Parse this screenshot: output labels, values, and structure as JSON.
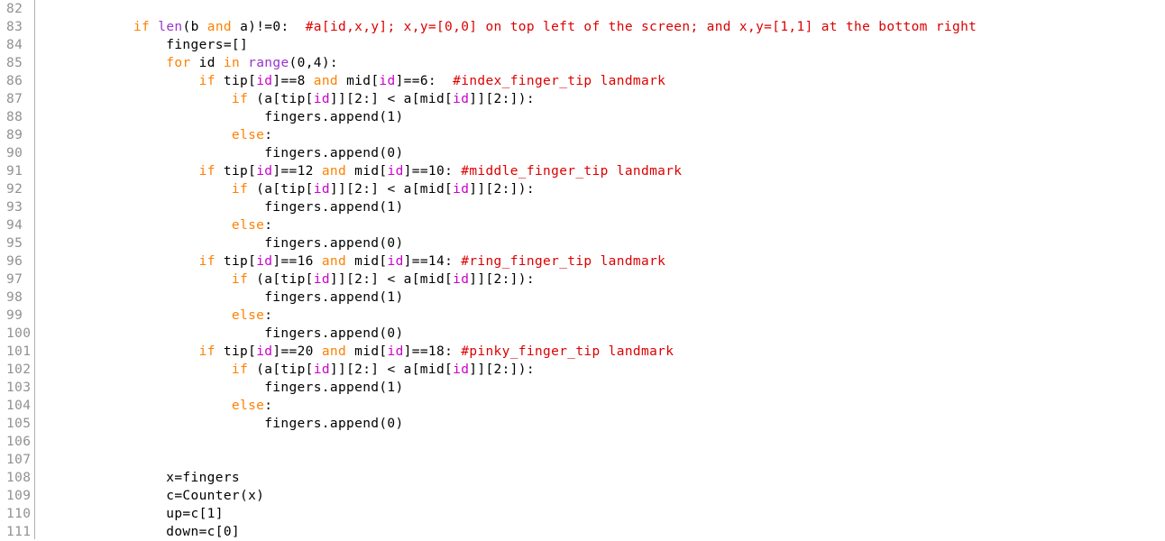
{
  "editor": {
    "language": "python",
    "background": "#ffffff",
    "gutter_text_color": "#8f9193",
    "gutter_border_color": "#b0b0b0",
    "colors": {
      "keyword": "#ff8000",
      "builtin": "#9933cc",
      "variable": "#cc00cc",
      "comment": "#dd0000",
      "default": "#000000"
    },
    "first_line_number": 82,
    "last_line_number": 111,
    "line_numbers": [
      82,
      83,
      84,
      85,
      86,
      87,
      88,
      89,
      90,
      91,
      92,
      93,
      94,
      95,
      96,
      97,
      98,
      99,
      100,
      101,
      102,
      103,
      104,
      105,
      106,
      107,
      108,
      109,
      110,
      111
    ],
    "lines": [
      {
        "number": 82,
        "text": "",
        "tokens": []
      },
      {
        "number": 83,
        "text": "            if len(b and a)!=0:  #a[id,x,y]; x,y=[0,0] on top left of the screen; and x,y=[1,1] at the bottom right",
        "tokens": [
          {
            "t": "            ",
            "c": "txt"
          },
          {
            "t": "if",
            "c": "kw"
          },
          {
            "t": " ",
            "c": "txt"
          },
          {
            "t": "len",
            "c": "bi"
          },
          {
            "t": "(b ",
            "c": "txt"
          },
          {
            "t": "and",
            "c": "kw"
          },
          {
            "t": " a)!=0:  ",
            "c": "txt"
          },
          {
            "t": "#a[id,x,y]; x,y=[0,0] on top left of the screen; and x,y=[1,1] at the bottom right",
            "c": "com"
          }
        ]
      },
      {
        "number": 84,
        "text": "                fingers=[]",
        "tokens": [
          {
            "t": "                fingers=[]",
            "c": "txt"
          }
        ]
      },
      {
        "number": 85,
        "text": "                for id in range(0,4):",
        "tokens": [
          {
            "t": "                ",
            "c": "txt"
          },
          {
            "t": "for",
            "c": "kw"
          },
          {
            "t": " id ",
            "c": "txt"
          },
          {
            "t": "in",
            "c": "kw"
          },
          {
            "t": " ",
            "c": "txt"
          },
          {
            "t": "range",
            "c": "bi"
          },
          {
            "t": "(0,4):",
            "c": "txt"
          }
        ]
      },
      {
        "number": 86,
        "text": "                    if tip[id]==8 and mid[id]==6:  #index_finger_tip landmark",
        "tokens": [
          {
            "t": "                    ",
            "c": "txt"
          },
          {
            "t": "if",
            "c": "kw"
          },
          {
            "t": " tip[",
            "c": "txt"
          },
          {
            "t": "id",
            "c": "var"
          },
          {
            "t": "]==8 ",
            "c": "txt"
          },
          {
            "t": "and",
            "c": "kw"
          },
          {
            "t": " mid[",
            "c": "txt"
          },
          {
            "t": "id",
            "c": "var"
          },
          {
            "t": "]==6:  ",
            "c": "txt"
          },
          {
            "t": "#index_finger_tip landmark",
            "c": "com"
          }
        ]
      },
      {
        "number": 87,
        "text": "                        if (a[tip[id]][2:] < a[mid[id]][2:]):",
        "tokens": [
          {
            "t": "                        ",
            "c": "txt"
          },
          {
            "t": "if",
            "c": "kw"
          },
          {
            "t": " (a[tip[",
            "c": "txt"
          },
          {
            "t": "id",
            "c": "var"
          },
          {
            "t": "]][2:] < a[mid[",
            "c": "txt"
          },
          {
            "t": "id",
            "c": "var"
          },
          {
            "t": "]][2:]):",
            "c": "txt"
          }
        ]
      },
      {
        "number": 88,
        "text": "                            fingers.append(1)",
        "tokens": [
          {
            "t": "                            fingers.append(1)",
            "c": "txt"
          }
        ]
      },
      {
        "number": 89,
        "text": "                        else:",
        "tokens": [
          {
            "t": "                        ",
            "c": "txt"
          },
          {
            "t": "else",
            "c": "kw"
          },
          {
            "t": ":",
            "c": "txt"
          }
        ]
      },
      {
        "number": 90,
        "text": "                            fingers.append(0)",
        "tokens": [
          {
            "t": "                            fingers.append(0)",
            "c": "txt"
          }
        ]
      },
      {
        "number": 91,
        "text": "                    if tip[id]==12 and mid[id]==10: #middle_finger_tip landmark",
        "tokens": [
          {
            "t": "                    ",
            "c": "txt"
          },
          {
            "t": "if",
            "c": "kw"
          },
          {
            "t": " tip[",
            "c": "txt"
          },
          {
            "t": "id",
            "c": "var"
          },
          {
            "t": "]==12 ",
            "c": "txt"
          },
          {
            "t": "and",
            "c": "kw"
          },
          {
            "t": " mid[",
            "c": "txt"
          },
          {
            "t": "id",
            "c": "var"
          },
          {
            "t": "]==10: ",
            "c": "txt"
          },
          {
            "t": "#middle_finger_tip landmark",
            "c": "com"
          }
        ]
      },
      {
        "number": 92,
        "text": "                        if (a[tip[id]][2:] < a[mid[id]][2:]):",
        "tokens": [
          {
            "t": "                        ",
            "c": "txt"
          },
          {
            "t": "if",
            "c": "kw"
          },
          {
            "t": " (a[tip[",
            "c": "txt"
          },
          {
            "t": "id",
            "c": "var"
          },
          {
            "t": "]][2:] < a[mid[",
            "c": "txt"
          },
          {
            "t": "id",
            "c": "var"
          },
          {
            "t": "]][2:]):",
            "c": "txt"
          }
        ]
      },
      {
        "number": 93,
        "text": "                            fingers.append(1)",
        "tokens": [
          {
            "t": "                            fingers.append(1)",
            "c": "txt"
          }
        ]
      },
      {
        "number": 94,
        "text": "                        else:",
        "tokens": [
          {
            "t": "                        ",
            "c": "txt"
          },
          {
            "t": "else",
            "c": "kw"
          },
          {
            "t": ":",
            "c": "txt"
          }
        ]
      },
      {
        "number": 95,
        "text": "                            fingers.append(0)",
        "tokens": [
          {
            "t": "                            fingers.append(0)",
            "c": "txt"
          }
        ]
      },
      {
        "number": 96,
        "text": "                    if tip[id]==16 and mid[id]==14: #ring_finger_tip landmark",
        "tokens": [
          {
            "t": "                    ",
            "c": "txt"
          },
          {
            "t": "if",
            "c": "kw"
          },
          {
            "t": " tip[",
            "c": "txt"
          },
          {
            "t": "id",
            "c": "var"
          },
          {
            "t": "]==16 ",
            "c": "txt"
          },
          {
            "t": "and",
            "c": "kw"
          },
          {
            "t": " mid[",
            "c": "txt"
          },
          {
            "t": "id",
            "c": "var"
          },
          {
            "t": "]==14: ",
            "c": "txt"
          },
          {
            "t": "#ring_finger_tip landmark",
            "c": "com"
          }
        ]
      },
      {
        "number": 97,
        "text": "                        if (a[tip[id]][2:] < a[mid[id]][2:]):",
        "tokens": [
          {
            "t": "                        ",
            "c": "txt"
          },
          {
            "t": "if",
            "c": "kw"
          },
          {
            "t": " (a[tip[",
            "c": "txt"
          },
          {
            "t": "id",
            "c": "var"
          },
          {
            "t": "]][2:] < a[mid[",
            "c": "txt"
          },
          {
            "t": "id",
            "c": "var"
          },
          {
            "t": "]][2:]):",
            "c": "txt"
          }
        ]
      },
      {
        "number": 98,
        "text": "                            fingers.append(1)",
        "tokens": [
          {
            "t": "                            fingers.append(1)",
            "c": "txt"
          }
        ]
      },
      {
        "number": 99,
        "text": "                        else:",
        "tokens": [
          {
            "t": "                        ",
            "c": "txt"
          },
          {
            "t": "else",
            "c": "kw"
          },
          {
            "t": ":",
            "c": "txt"
          }
        ]
      },
      {
        "number": 100,
        "text": "                            fingers.append(0)",
        "tokens": [
          {
            "t": "                            fingers.append(0)",
            "c": "txt"
          }
        ]
      },
      {
        "number": 101,
        "text": "                    if tip[id]==20 and mid[id]==18: #pinky_finger_tip landmark",
        "tokens": [
          {
            "t": "                    ",
            "c": "txt"
          },
          {
            "t": "if",
            "c": "kw"
          },
          {
            "t": " tip[",
            "c": "txt"
          },
          {
            "t": "id",
            "c": "var"
          },
          {
            "t": "]==20 ",
            "c": "txt"
          },
          {
            "t": "and",
            "c": "kw"
          },
          {
            "t": " mid[",
            "c": "txt"
          },
          {
            "t": "id",
            "c": "var"
          },
          {
            "t": "]==18: ",
            "c": "txt"
          },
          {
            "t": "#pinky_finger_tip landmark",
            "c": "com"
          }
        ]
      },
      {
        "number": 102,
        "text": "                        if (a[tip[id]][2:] < a[mid[id]][2:]):",
        "tokens": [
          {
            "t": "                        ",
            "c": "txt"
          },
          {
            "t": "if",
            "c": "kw"
          },
          {
            "t": " (a[tip[",
            "c": "txt"
          },
          {
            "t": "id",
            "c": "var"
          },
          {
            "t": "]][2:] < a[mid[",
            "c": "txt"
          },
          {
            "t": "id",
            "c": "var"
          },
          {
            "t": "]][2:]):",
            "c": "txt"
          }
        ]
      },
      {
        "number": 103,
        "text": "                            fingers.append(1)",
        "tokens": [
          {
            "t": "                            fingers.append(1)",
            "c": "txt"
          }
        ]
      },
      {
        "number": 104,
        "text": "                        else:",
        "tokens": [
          {
            "t": "                        ",
            "c": "txt"
          },
          {
            "t": "else",
            "c": "kw"
          },
          {
            "t": ":",
            "c": "txt"
          }
        ]
      },
      {
        "number": 105,
        "text": "                            fingers.append(0)",
        "tokens": [
          {
            "t": "                            fingers.append(0)",
            "c": "txt"
          }
        ]
      },
      {
        "number": 106,
        "text": "",
        "tokens": []
      },
      {
        "number": 107,
        "text": "",
        "tokens": []
      },
      {
        "number": 108,
        "text": "                x=fingers",
        "tokens": [
          {
            "t": "                x=fingers",
            "c": "txt"
          }
        ]
      },
      {
        "number": 109,
        "text": "                c=Counter(x)",
        "tokens": [
          {
            "t": "                c=Counter(x)",
            "c": "txt"
          }
        ]
      },
      {
        "number": 110,
        "text": "                up=c[1]",
        "tokens": [
          {
            "t": "                up=c[1]",
            "c": "txt"
          }
        ]
      },
      {
        "number": 111,
        "text": "                down=c[0]",
        "tokens": [
          {
            "t": "                down=c[0]",
            "c": "txt"
          }
        ]
      }
    ]
  }
}
